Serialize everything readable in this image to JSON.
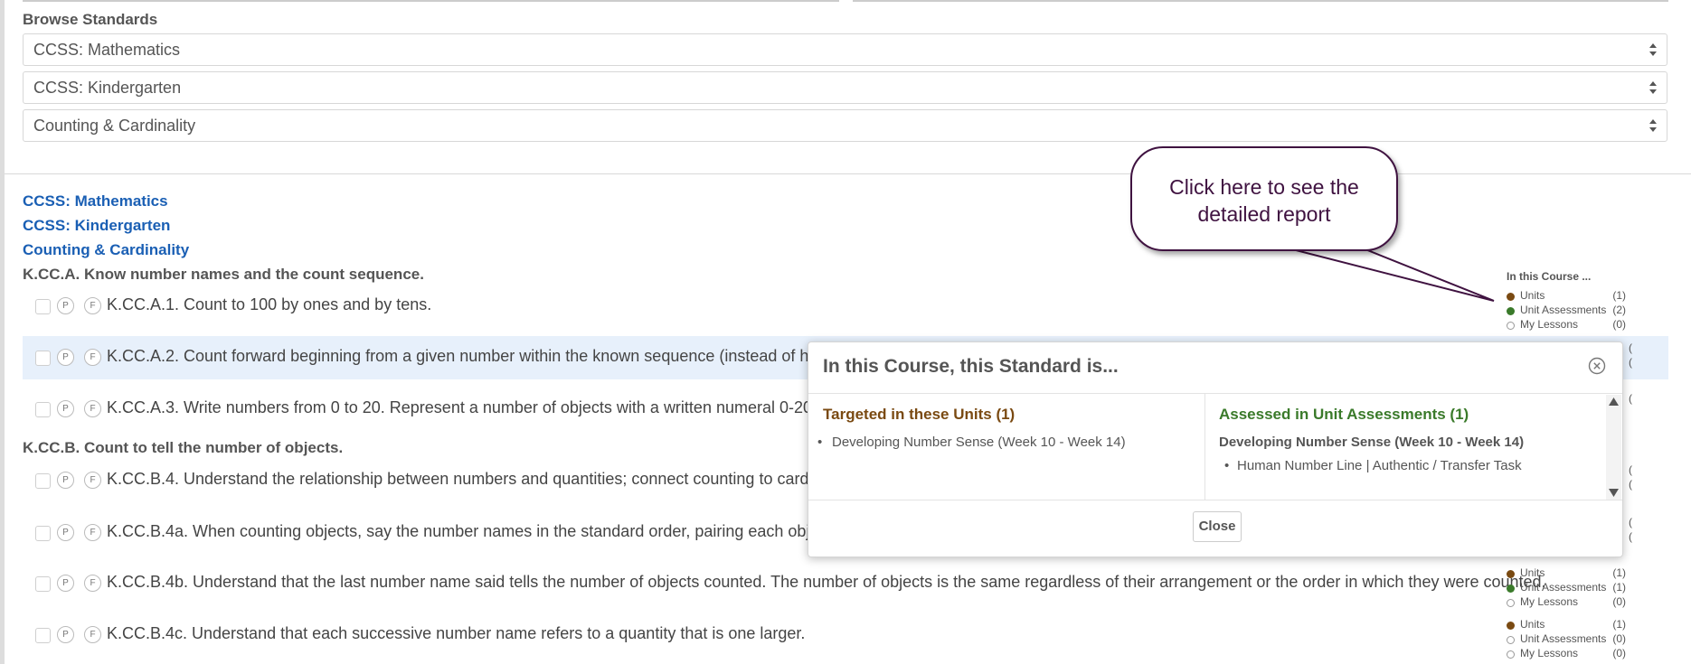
{
  "browse": {
    "title": "Browse Standards",
    "select1": "CCSS: Mathematics",
    "select2": "CCSS: Kindergarten",
    "select3": "Counting & Cardinality"
  },
  "breadcrumbs": [
    "CCSS: Mathematics",
    "CCSS: Kindergarten",
    "Counting & Cardinality"
  ],
  "groups": [
    {
      "heading": "K.CC.A. Know number names and the count sequence."
    },
    {
      "heading": "K.CC.B. Count to tell the number of objects."
    }
  ],
  "badges": {
    "p": "P",
    "f": "F"
  },
  "standards": [
    {
      "text": "K.CC.A.1. Count to 100 by ones and by tens."
    },
    {
      "text": "K.CC.A.2. Count forward beginning from a given number within the known sequence (instead of havin"
    },
    {
      "text": "K.CC.A.3. Write numbers from 0 to 20. Represent a number of objects with a written numeral 0-20 (w"
    },
    {
      "text": "K.CC.B.4. Understand the relationship between numbers and quantities; connect counting to cardinali"
    },
    {
      "text": "K.CC.B.4a. When counting objects, say the number names in the standard order, pairing each object w"
    },
    {
      "text": "K.CC.B.4b. Understand that the last number name said tells the number of objects counted. The number of objects is the same regardless of their arrangement or the order in which they were counted."
    },
    {
      "text": "K.CC.B.4c. Understand that each successive number name refers to a quantity that is one larger."
    }
  ],
  "legend": {
    "title": "In this Course ...",
    "blocks": [
      {
        "units": "(1)",
        "assessments": "(2)",
        "lessons": "(0)",
        "units_filled": true,
        "assess_filled": true
      },
      {
        "units": "(1)",
        "assessments": "(1)",
        "lessons": "(0)",
        "units_filled": true,
        "assess_filled": true
      },
      {
        "units": "(1)",
        "assessments": "(0)",
        "lessons": "(0)",
        "units_filled": true,
        "assess_filled": false
      }
    ],
    "labels": {
      "units": "Units",
      "assessments": "Unit Assessments",
      "lessons": "My Lessons"
    },
    "colors": {
      "units": "#7a4a12",
      "assessments": "#3a7a2a"
    }
  },
  "callout": {
    "line1": "Click here to see the",
    "line2": "detailed report"
  },
  "modal": {
    "title": "In this Course, this Standard is...",
    "targeted_heading": "Targeted in these Units (1)",
    "targeted_items": [
      "Developing Number Sense (Week 10 - Week 14)"
    ],
    "assessed_heading": "Assessed in Unit Assessments (1)",
    "assessed_unit": "Developing Number Sense (Week 10 - Week 14)",
    "assessed_items": [
      "Human Number Line | Authentic / Transfer Task"
    ],
    "close_label": "Close"
  },
  "partial_counts": {
    "a2": [
      "(",
      "("
    ],
    "a3": [
      "("
    ],
    "b4": [
      "(",
      "("
    ],
    "b4a": [
      "(",
      "("
    ]
  }
}
